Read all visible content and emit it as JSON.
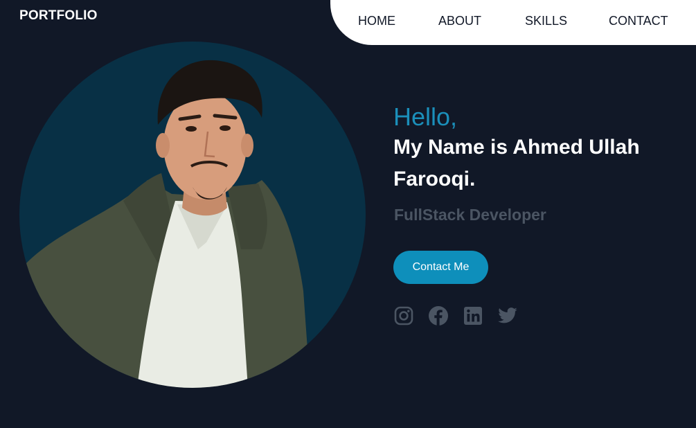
{
  "brand": {
    "label": "PORTFOLIO"
  },
  "nav": {
    "items": [
      {
        "label": "HOME"
      },
      {
        "label": "ABOUT"
      },
      {
        "label": "SKILLS"
      },
      {
        "label": "CONTACT"
      }
    ]
  },
  "hero": {
    "greeting": "Hello,",
    "name": "My Name is Ahmed Ullah Farooqi.",
    "role": "FullStack Developer",
    "cta_label": "Contact Me",
    "socials": [
      {
        "icon": "instagram-icon"
      },
      {
        "icon": "facebook-icon"
      },
      {
        "icon": "linkedin-icon"
      },
      {
        "icon": "twitter-icon"
      }
    ]
  },
  "colors": {
    "background": "#111827",
    "accent": "#0e8fbb",
    "nav_background": "#ffffff",
    "muted": "#4b5563",
    "portrait_circle": "#083045"
  }
}
